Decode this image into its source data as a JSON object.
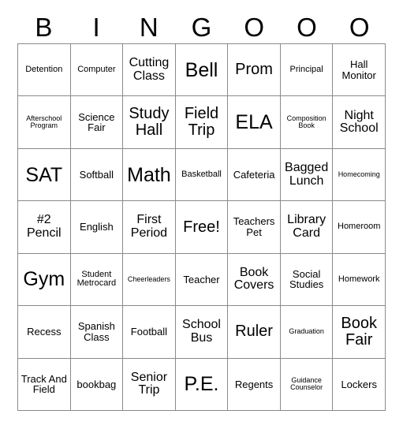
{
  "card": {
    "title_letters": [
      "B",
      "I",
      "N",
      "G",
      "O",
      "O",
      "O"
    ],
    "columns": 7,
    "rows": 7,
    "free_space_label": "Free!",
    "colors": {
      "background": "#ffffff",
      "grid_line": "#8a8a8a",
      "text": "#000000"
    },
    "cells": [
      [
        {
          "label": "Detention",
          "size": "s"
        },
        {
          "label": "Computer",
          "size": "s"
        },
        {
          "label": "Cutting Class",
          "size": "l"
        },
        {
          "label": "Bell",
          "size": "xxl"
        },
        {
          "label": "Prom",
          "size": "xl"
        },
        {
          "label": "Principal",
          "size": "s"
        },
        {
          "label": "Hall Monitor",
          "size": "m"
        }
      ],
      [
        {
          "label": "Afterschool Program",
          "size": "xs"
        },
        {
          "label": "Science Fair",
          "size": "m"
        },
        {
          "label": "Study Hall",
          "size": "xl"
        },
        {
          "label": "Field Trip",
          "size": "xl"
        },
        {
          "label": "ELA",
          "size": "xxl"
        },
        {
          "label": "Composition Book",
          "size": "xs"
        },
        {
          "label": "Night School",
          "size": "l"
        }
      ],
      [
        {
          "label": "SAT",
          "size": "xxl"
        },
        {
          "label": "Softball",
          "size": "m"
        },
        {
          "label": "Math",
          "size": "xxl"
        },
        {
          "label": "Basketball",
          "size": "s"
        },
        {
          "label": "Cafeteria",
          "size": "m"
        },
        {
          "label": "Bagged Lunch",
          "size": "l"
        },
        {
          "label": "Homecoming",
          "size": "xs"
        }
      ],
      [
        {
          "label": "#2 Pencil",
          "size": "l"
        },
        {
          "label": "English",
          "size": "m"
        },
        {
          "label": "First Period",
          "size": "l"
        },
        {
          "label": "Free!",
          "size": "xl"
        },
        {
          "label": "Teachers Pet",
          "size": "m"
        },
        {
          "label": "Library Card",
          "size": "l"
        },
        {
          "label": "Homeroom",
          "size": "s"
        }
      ],
      [
        {
          "label": "Gym",
          "size": "xxl"
        },
        {
          "label": "Student Metrocard",
          "size": "s"
        },
        {
          "label": "Cheerleaders",
          "size": "xs"
        },
        {
          "label": "Teacher",
          "size": "m"
        },
        {
          "label": "Book Covers",
          "size": "l"
        },
        {
          "label": "Social Studies",
          "size": "m"
        },
        {
          "label": "Homework",
          "size": "s"
        }
      ],
      [
        {
          "label": "Recess",
          "size": "m"
        },
        {
          "label": "Spanish Class",
          "size": "m"
        },
        {
          "label": "Football",
          "size": "m"
        },
        {
          "label": "School Bus",
          "size": "l"
        },
        {
          "label": "Ruler",
          "size": "xl"
        },
        {
          "label": "Graduation",
          "size": "xs"
        },
        {
          "label": "Book Fair",
          "size": "xl"
        }
      ],
      [
        {
          "label": "Track And Field",
          "size": "m"
        },
        {
          "label": "bookbag",
          "size": "m"
        },
        {
          "label": "Senior Trip",
          "size": "l"
        },
        {
          "label": "P.E.",
          "size": "xxl"
        },
        {
          "label": "Regents",
          "size": "m"
        },
        {
          "label": "Guidance Counselor",
          "size": "xs"
        },
        {
          "label": "Lockers",
          "size": "m"
        }
      ]
    ]
  }
}
